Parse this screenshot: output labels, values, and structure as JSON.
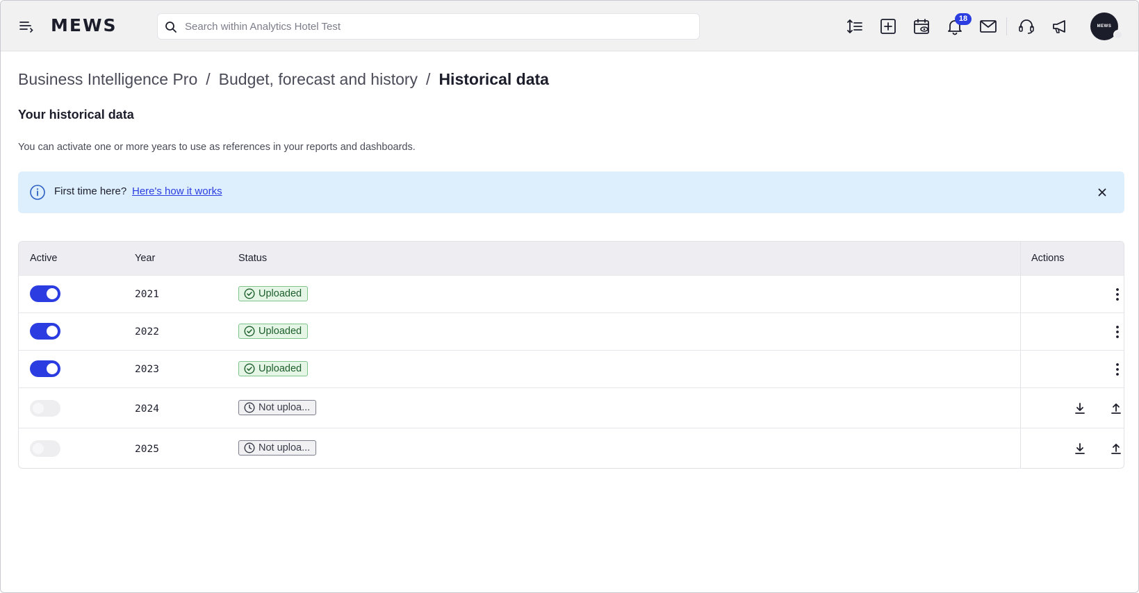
{
  "header": {
    "logo": "MEWS",
    "search_placeholder": "Search within Analytics Hotel Test",
    "notification_count": "18",
    "avatar_text": "MEWS",
    "icons": [
      "menu-icon",
      "sort-lines-icon",
      "add-square-icon",
      "calendar-view-icon",
      "bell-icon",
      "mail-icon",
      "headset-icon",
      "megaphone-icon"
    ]
  },
  "breadcrumb": {
    "items": [
      "Business Intelligence Pro",
      "Budget, forecast and history"
    ],
    "separator": "/",
    "current": "Historical data"
  },
  "section": {
    "title": "Your historical data",
    "description": "You can activate one or more years to use as references in your reports and dashboards."
  },
  "banner": {
    "text": "First time here?",
    "link": "Here's how it works"
  },
  "table": {
    "headers": {
      "active": "Active",
      "year": "Year",
      "status": "Status",
      "actions": "Actions"
    },
    "rows": [
      {
        "active": true,
        "year": "2021",
        "status": "Uploaded"
      },
      {
        "active": true,
        "year": "2022",
        "status": "Uploaded"
      },
      {
        "active": true,
        "year": "2023",
        "status": "Uploaded"
      },
      {
        "active": false,
        "year": "2024",
        "status": "Not uploa..."
      },
      {
        "active": false,
        "year": "2025",
        "status": "Not uploa..."
      }
    ]
  },
  "colors": {
    "accent": "#2b3de0",
    "banner_bg": "#ddeefc",
    "uploaded_bg": "#e5f6e7",
    "uploaded_border": "#7dc38a"
  }
}
